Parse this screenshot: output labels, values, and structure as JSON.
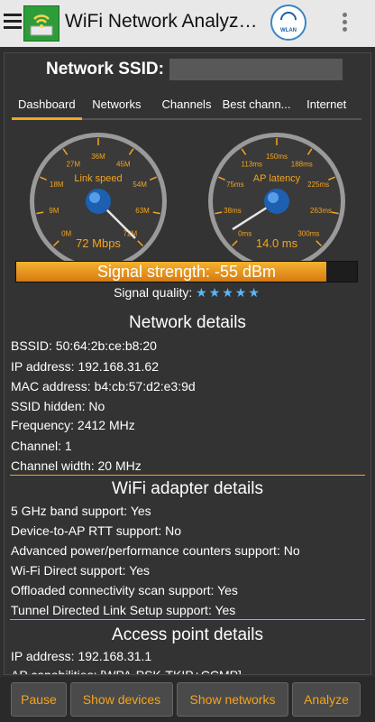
{
  "app": {
    "title": "WiFi Network Analyz…",
    "wlan_label": "WLAN"
  },
  "ssid": {
    "label": "Network SSID:"
  },
  "tabs": [
    {
      "label": "Dashboard",
      "active": true
    },
    {
      "label": "Networks"
    },
    {
      "label": "Channels"
    },
    {
      "label": "Best chann..."
    },
    {
      "label": "Internet"
    }
  ],
  "gauges": {
    "link_speed": {
      "title": "Link speed",
      "value_text": "72 Mbps",
      "value": 72,
      "ticks": [
        "0M",
        "9M",
        "18M",
        "27M",
        "36M",
        "45M",
        "54M",
        "63M",
        "72M"
      ]
    },
    "latency": {
      "title": "AP latency",
      "value_text": "14.0 ms",
      "value": 14.0,
      "ticks": [
        "0ms",
        "38ms",
        "75ms",
        "113ms",
        "150ms",
        "188ms",
        "225ms",
        "263ms",
        "300ms"
      ]
    }
  },
  "signal": {
    "text": "Signal strength: -55 dBm",
    "fraction": 0.91,
    "quality_label": "Signal quality:",
    "stars": "★★★★★",
    "star_count": 5
  },
  "network_details": {
    "title": "Network details",
    "rows": [
      "BSSID: 50:64:2b:ce:b8:20",
      "IP address: 192.168.31.62",
      "MAC address: b4:cb:57:d2:e3:9d",
      "SSID hidden: No",
      "Frequency: 2412 MHz",
      "Channel: 1",
      "Channel width: 20 MHz"
    ]
  },
  "adapter_details": {
    "title": "WiFi adapter details",
    "rows": [
      "5 GHz band support: Yes",
      "Device-to-AP RTT support: No",
      "Advanced power/performance counters support: No",
      "Wi-Fi Direct support: Yes",
      "Offloaded connectivity scan support: Yes",
      "Tunnel Directed Link Setup support: Yes"
    ]
  },
  "ap_details": {
    "title": "Access point details",
    "rows": [
      "IP address: 192.168.31.1",
      "AP capabilities: [WPA-PSK-TKIP+CCMP]"
    ]
  },
  "buttons": {
    "pause": "Pause",
    "show_devices": "Show devices",
    "show_networks": "Show networks",
    "analyze": "Analyze"
  },
  "colors": {
    "accent": "#f4a41e",
    "star": "#5bb6f0"
  }
}
